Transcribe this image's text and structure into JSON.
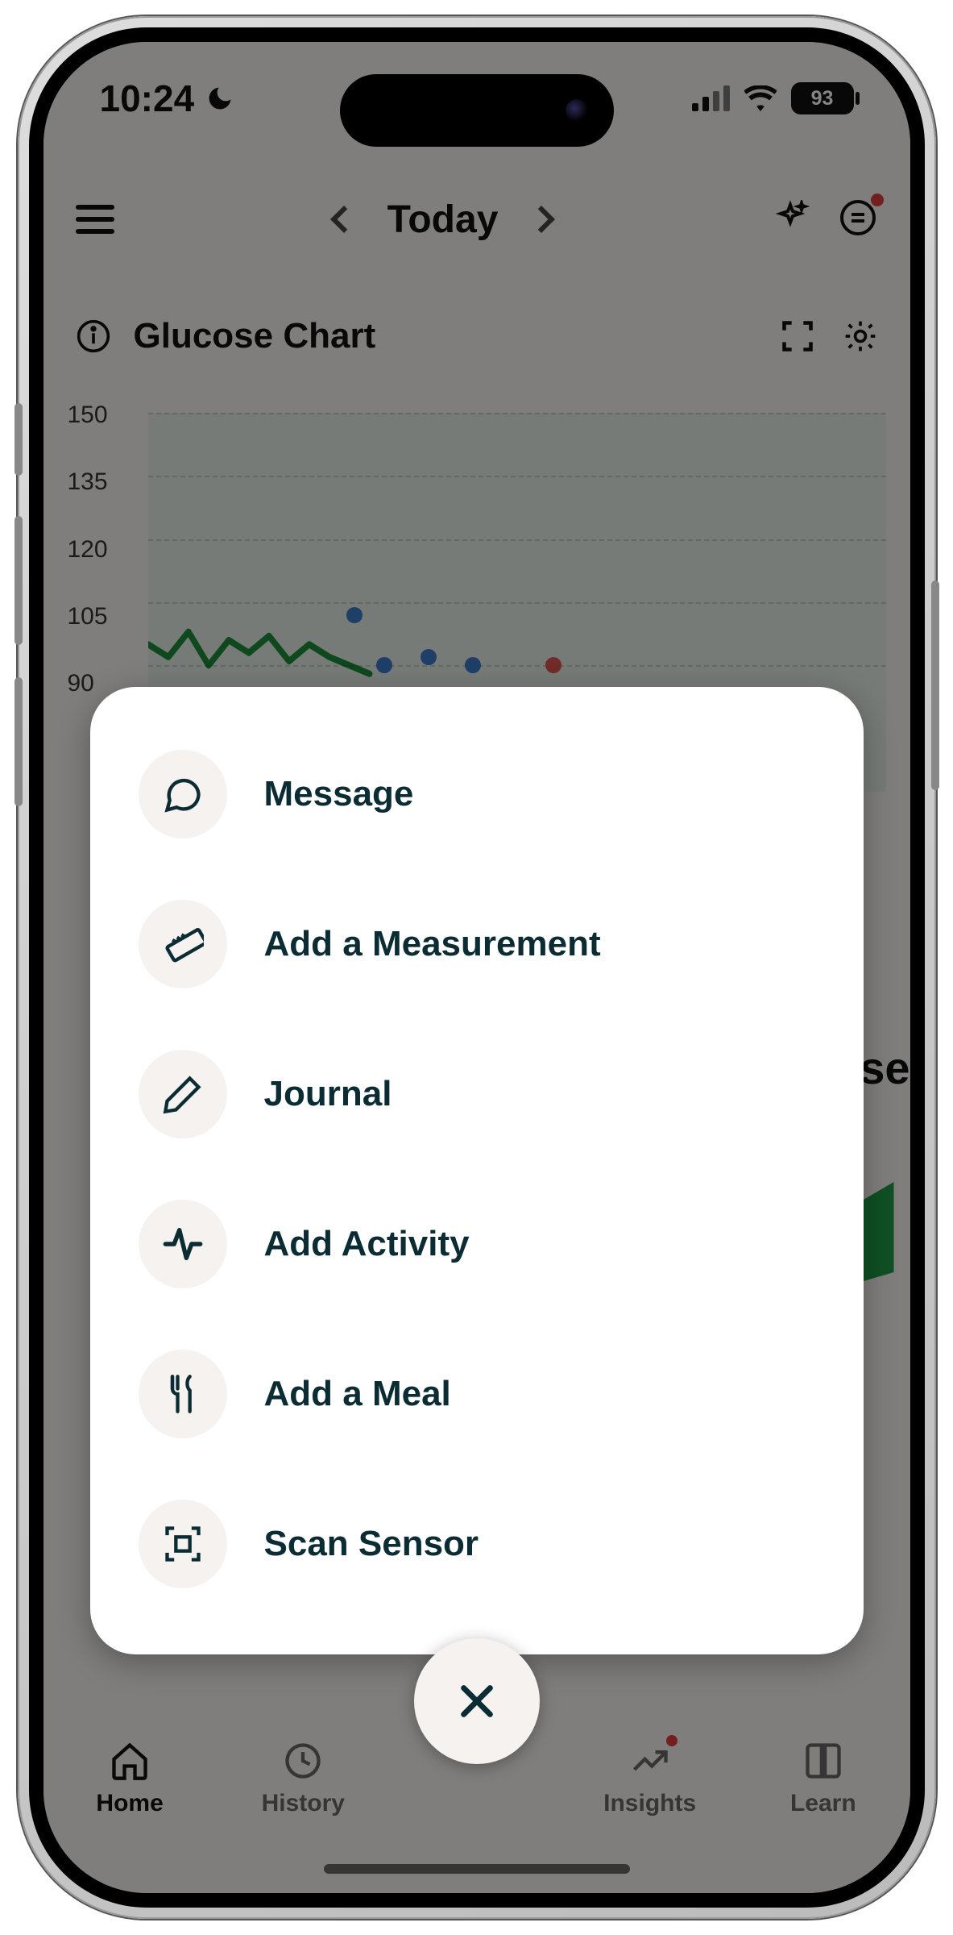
{
  "status": {
    "time": "10:24",
    "battery": "93"
  },
  "header": {
    "title": "Today"
  },
  "section": {
    "title": "Glucose Chart"
  },
  "chart_data": {
    "type": "line",
    "ylim": [
      60,
      150
    ],
    "y_ticks": [
      150,
      135,
      120,
      105,
      90
    ],
    "title": "",
    "xlabel": "",
    "ylabel": "",
    "series": [
      {
        "name": "glucose",
        "values": [
          95,
          92,
          98,
          90,
          96,
          93,
          97,
          91,
          95,
          92,
          90,
          88
        ]
      }
    ],
    "markers": [
      {
        "x_pct": 28,
        "y_value": 102,
        "color": "blue"
      },
      {
        "x_pct": 32,
        "y_value": 90,
        "color": "blue"
      },
      {
        "x_pct": 38,
        "y_value": 92,
        "color": "blue"
      },
      {
        "x_pct": 44,
        "y_value": 90,
        "color": "blue"
      },
      {
        "x_pct": 55,
        "y_value": 90,
        "color": "red"
      }
    ]
  },
  "peek_text": "se",
  "sheet": {
    "items": [
      {
        "id": "message",
        "label": "Message",
        "icon": "chat-bubble-icon"
      },
      {
        "id": "measurement",
        "label": "Add a Measurement",
        "icon": "ruler-icon"
      },
      {
        "id": "journal",
        "label": "Journal",
        "icon": "pencil-icon"
      },
      {
        "id": "activity",
        "label": "Add Activity",
        "icon": "activity-icon"
      },
      {
        "id": "meal",
        "label": "Add a Meal",
        "icon": "utensils-icon"
      },
      {
        "id": "scan",
        "label": "Scan Sensor",
        "icon": "scan-icon"
      }
    ]
  },
  "tabs": {
    "items": [
      {
        "id": "home",
        "label": "Home",
        "icon": "home-icon",
        "active": true
      },
      {
        "id": "history",
        "label": "History",
        "icon": "clock-icon",
        "active": false
      },
      {
        "id": "insights",
        "label": "Insights",
        "icon": "trend-icon",
        "active": false,
        "dot": true
      },
      {
        "id": "learn",
        "label": "Learn",
        "icon": "book-icon",
        "active": false
      }
    ]
  }
}
